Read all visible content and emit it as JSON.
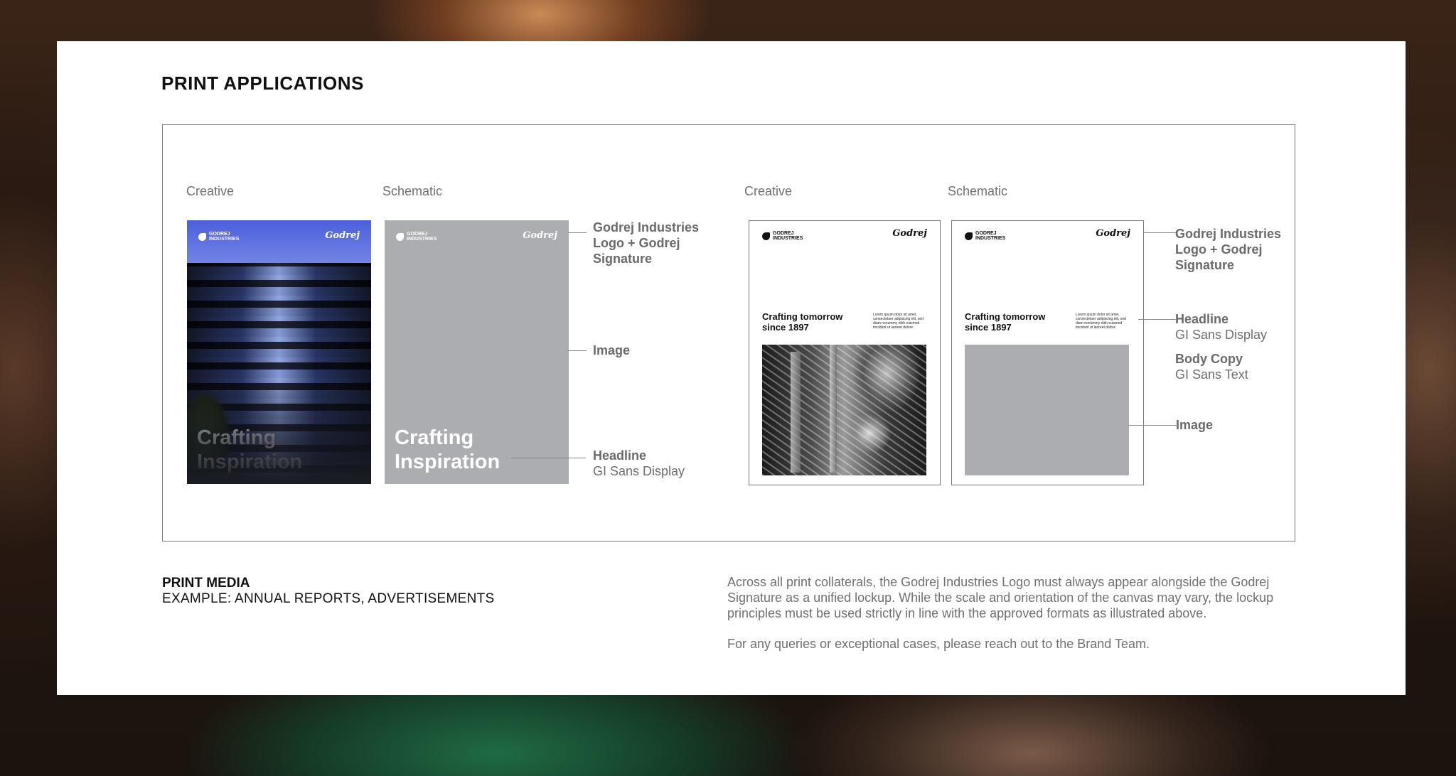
{
  "page": {
    "title": "PRINT APPLICATIONS"
  },
  "left_group": {
    "creative_label": "Creative",
    "schematic_label": "Schematic",
    "logo_text_line1": "GODREJ",
    "logo_text_line2": "INDUSTRIES",
    "signature_text": "Godrej",
    "headline_line1": "Crafting",
    "headline_line2": "Inspiration",
    "annotations": {
      "logo_signature": "Godrej Industries Logo + Godrej Signature",
      "image": "Image",
      "headline": "Headline",
      "headline_font": "GI Sans Display"
    }
  },
  "right_group": {
    "creative_label": "Creative",
    "schematic_label": "Schematic",
    "logo_text_line1": "GODREJ",
    "logo_text_line2": "INDUSTRIES",
    "signature_text": "Godrej",
    "headline_line1": "Crafting tomorrow",
    "headline_line2": "since 1897",
    "body_copy": "Lorem ipsum dolor sit amet, consectetuer adipiscing elit, sed diam nonummy nibh euismod tincidunt ut laoreet dolore",
    "annotations": {
      "logo_signature": "Godrej Industries Logo + Godrej Signature",
      "headline": "Headline",
      "headline_font": "GI Sans Display",
      "body_copy": "Body Copy",
      "body_copy_font": "GI Sans Text",
      "image": "Image"
    }
  },
  "footer": {
    "media_title": "PRINT MEDIA",
    "media_example": "EXAMPLE: ANNUAL REPORTS, ADVERTISEMENTS",
    "paragraph1": "Across all print collaterals, the Godrej Industries Logo must always appear alongside the Godrej Signature as a unified lockup. While the scale and orientation of the canvas may vary, the lockup principles must be used strictly in line with the approved formats as illustrated above.",
    "paragraph2": "For any queries or exceptional cases, please reach out to the Brand Team."
  },
  "colors": {
    "schematic_gray": "#acadb0",
    "annotation_text": "#6e6e6e",
    "card_background": "#ffffff"
  }
}
